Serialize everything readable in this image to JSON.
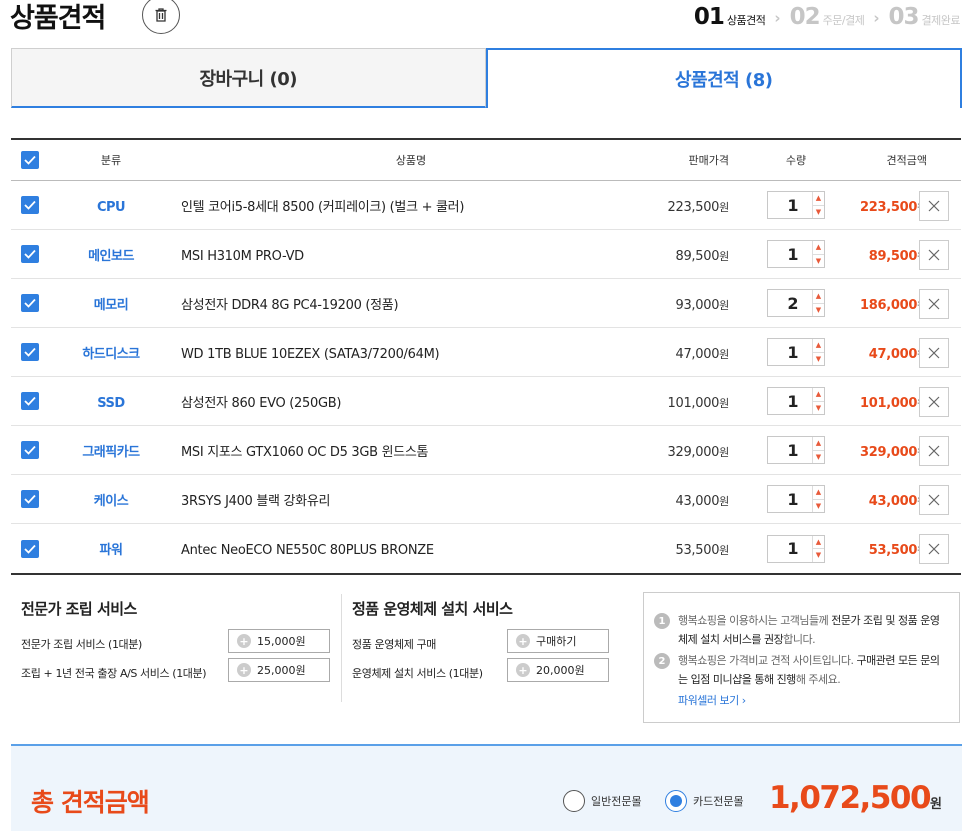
{
  "header": {
    "title": "상품견적",
    "trash_icon": "trash-icon",
    "steps": [
      {
        "num": "01",
        "label": "상품견적",
        "active": true
      },
      {
        "num": "02",
        "label": "주문/결제",
        "active": false
      },
      {
        "num": "03",
        "label": "결제완료",
        "active": false
      }
    ]
  },
  "tabs": {
    "cart": "장바구니 (0)",
    "estimate": "상품견적 (8)"
  },
  "table": {
    "headers": {
      "category": "분류",
      "name": "상품명",
      "price": "판매가격",
      "qty": "수량",
      "total": "견적금액"
    },
    "unit": "원",
    "rows": [
      {
        "category": "CPU",
        "name": "인텔 코어i5-8세대 8500 (커피레이크) (벌크 + 쿨러)",
        "price": "223,500",
        "qty": "1",
        "total": "223,500"
      },
      {
        "category": "메인보드",
        "name": "MSI H310M PRO-VD",
        "price": "89,500",
        "qty": "1",
        "total": "89,500"
      },
      {
        "category": "메모리",
        "name": "삼성전자 DDR4 8G PC4-19200 (정품)",
        "price": "93,000",
        "qty": "2",
        "total": "186,000"
      },
      {
        "category": "하드디스크",
        "name": "WD 1TB BLUE 10EZEX (SATA3/7200/64M)",
        "price": "47,000",
        "qty": "1",
        "total": "47,000"
      },
      {
        "category": "SSD",
        "name": "삼성전자 860 EVO (250GB)",
        "price": "101,000",
        "qty": "1",
        "total": "101,000"
      },
      {
        "category": "그래픽카드",
        "name": "MSI 지포스 GTX1060 OC D5 3GB 윈드스톰",
        "price": "329,000",
        "qty": "1",
        "total": "329,000"
      },
      {
        "category": "케이스",
        "name": "3RSYS J400 블랙 강화유리",
        "price": "43,000",
        "qty": "1",
        "total": "43,000"
      },
      {
        "category": "파워",
        "name": "Antec NeoECO NE550C 80PLUS BRONZE",
        "price": "53,500",
        "qty": "1",
        "total": "53,500"
      }
    ]
  },
  "assembly": {
    "title": "전문가 조립 서비스",
    "items": [
      {
        "label": "전문가 조립 서비스 (1대분)",
        "button": "15,000원"
      },
      {
        "label": "조립 + 1년 전국 출장 A/S 서비스 (1대분)",
        "button": "25,000원"
      }
    ]
  },
  "os": {
    "title": "정품 운영체제 설치 서비스",
    "items": [
      {
        "label": "정품 운영체제 구매",
        "button": "구매하기"
      },
      {
        "label": "운영체제 설치 서비스 (1대분)",
        "button": "20,000원"
      }
    ]
  },
  "notice": {
    "n1": "1",
    "n1_pre": "행복쇼핑을 이용하시는 고객님들께 ",
    "n1_em": "전문가 조립 및 정품 운영체제 설치 서비스를 권장",
    "n1_post": "합니다.",
    "n2": "2",
    "n2_pre": "행복쇼핑은 가격비교 견적 사이트입니다. ",
    "n2_em": "구매관련 모든 문의는 입점 미니샵을 통해 진행",
    "n2_post": "해 주세요.",
    "link": "파워셀러 보기 ›"
  },
  "footer": {
    "title": "총 견적금액",
    "radio1": "일반전문몰",
    "radio2": "카드전문몰",
    "selected": "radio2",
    "amount": "1,072,500",
    "unit": "원"
  },
  "colors": {
    "accent": "#2f7fe0",
    "price": "#e84a1a"
  }
}
